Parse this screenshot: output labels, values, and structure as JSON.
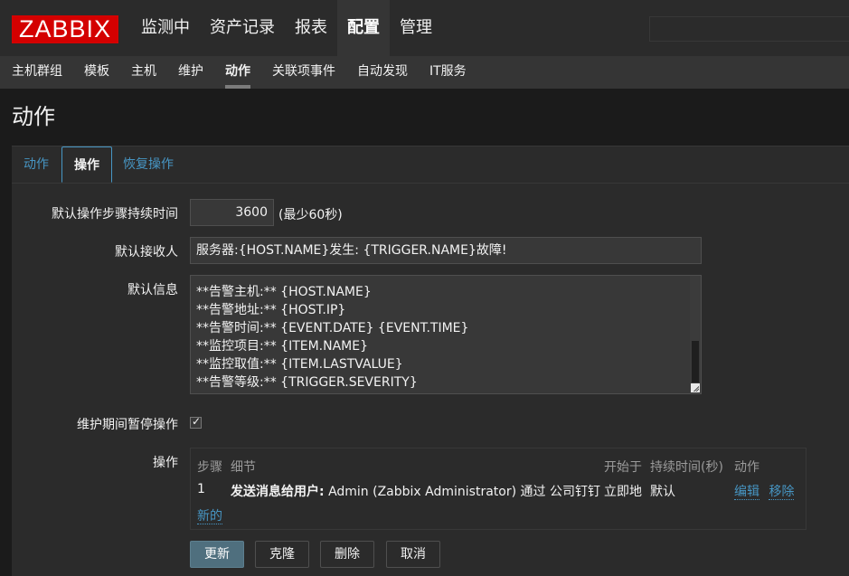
{
  "brand": {
    "logo": "ZABBIX"
  },
  "main_nav": [
    "监测中",
    "资产记录",
    "报表",
    "配置",
    "管理"
  ],
  "main_nav_active": "配置",
  "sub_nav": [
    "主机群组",
    "模板",
    "主机",
    "维护",
    "动作",
    "关联项事件",
    "自动发现",
    "IT服务"
  ],
  "sub_nav_active": "动作",
  "page_title": "动作",
  "tabs": {
    "action": "动作",
    "operations": "操作",
    "recovery": "恢复操作"
  },
  "form": {
    "step_duration_label": "默认操作步骤持续时间",
    "step_duration_value": "3600",
    "step_duration_hint": "(最少60秒)",
    "recipient_label": "默认接收人",
    "recipient_value": "服务器:{HOST.NAME}发生: {TRIGGER.NAME}故障!",
    "message_label": "默认信息",
    "message_lines": [
      "**告警主机:** {HOST.NAME}",
      "**告警地址:** {HOST.IP}",
      "**告警时间:** {EVENT.DATE} {EVENT.TIME}",
      "**监控项目:** {ITEM.NAME}",
      "**监控取值:** {ITEM.LASTVALUE}",
      "**告警等级:** {TRIGGER.SEVERITY}"
    ],
    "pause_label": "维护期间暂停操作",
    "pause_checked": true,
    "operations_label": "操作"
  },
  "operations_table": {
    "headers": {
      "step": "步骤",
      "details": "细节",
      "start_in": "开始于",
      "duration": "持续时间(秒)",
      "action": "动作"
    },
    "row": {
      "step": "1",
      "details_bold": "发送消息给用户:",
      "details_rest": "Admin (Zabbix Administrator) 通过 公司钉钉",
      "start_in": "立即地",
      "duration": "默认",
      "edit": "编辑",
      "remove": "移除"
    },
    "new_link": "新的"
  },
  "buttons": {
    "update": "更新",
    "clone": "克隆",
    "delete": "删除",
    "cancel": "取消"
  },
  "colors": {
    "brand_red": "#d40000",
    "link_blue": "#4796c4",
    "primary_button": "#4f6f7e"
  }
}
